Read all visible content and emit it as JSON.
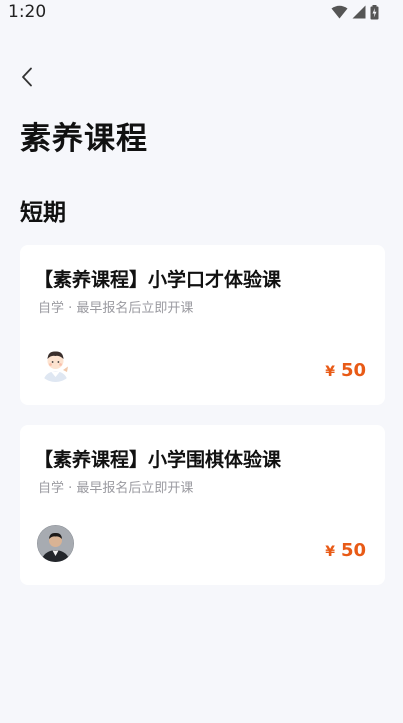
{
  "status_bar": {
    "time": "1:20"
  },
  "header": {
    "title": "素养课程"
  },
  "section": {
    "title": "短期"
  },
  "courses": [
    {
      "title": "【素养课程】小学口才体验课",
      "meta": "自学 · 最早报名后立即开课",
      "currency": "¥",
      "price": "50",
      "avatar_icon": "teacher-avatar-cartoon"
    },
    {
      "title": "【素养课程】小学围棋体验课",
      "meta": "自学 · 最早报名后立即开课",
      "currency": "¥",
      "price": "50",
      "avatar_icon": "teacher-avatar-photo"
    }
  ],
  "colors": {
    "accent": "#e85a16",
    "background": "#f6f7fb",
    "card": "#ffffff",
    "meta_text": "#9a9aa0"
  }
}
